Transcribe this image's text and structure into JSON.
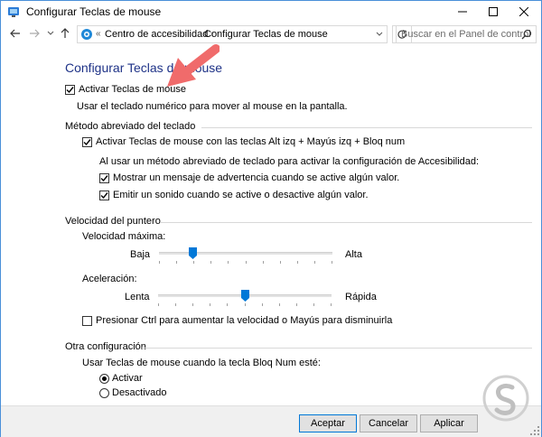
{
  "window": {
    "title": "Configurar Teclas de mouse"
  },
  "address": {
    "chevron": "«",
    "crumbs": [
      "Centro de accesibilidad",
      "Configurar Teclas de mouse"
    ],
    "search_placeholder": "Buscar en el Panel de control"
  },
  "page": {
    "heading": "Configurar Teclas de mouse",
    "activate_label": "Activar Teclas de mouse",
    "activate_checked": true,
    "activate_desc": "Usar el teclado numérico para mover al mouse en la pantalla.",
    "shortcut": {
      "title": "Método abreviado del teclado",
      "enable_label": "Activar Teclas de mouse con las teclas Alt izq + Mayús izq + Bloq num",
      "enable_checked": true,
      "info": "Al usar un método abreviado de teclado para activar la configuración de Accesibilidad:",
      "warning_label": "Mostrar un mensaje de advertencia cuando se active algún valor.",
      "warning_checked": true,
      "sound_label": "Emitir un sonido cuando se active o desactive algún valor.",
      "sound_checked": true
    },
    "pointer": {
      "title": "Velocidad del puntero",
      "max_speed_label": "Velocidad máxima:",
      "max_low": "Baja",
      "max_high": "Alta",
      "max_speed_value": 0.18,
      "accel_label": "Aceleración:",
      "accel_low": "Lenta",
      "accel_high": "Rápida",
      "accel_value": 0.5,
      "ctrl_label": "Presionar Ctrl para aumentar la velocidad o Mayús para disminuirla",
      "ctrl_checked": false
    },
    "other": {
      "title": "Otra configuración",
      "bloq_label": "Usar Teclas de mouse cuando la tecla Bloq Num esté:",
      "opt_on": "Activar",
      "opt_off": "Desactivado",
      "selected": "Activar"
    }
  },
  "buttons": {
    "ok": "Aceptar",
    "cancel": "Cancelar",
    "apply": "Aplicar"
  },
  "colors": {
    "heading": "#1e3287",
    "accent": "#0078d7",
    "arrow": "#f06b6b"
  },
  "icons": [
    "app-icon",
    "back-arrow-icon",
    "forward-arrow-icon",
    "recent-dropdown-icon",
    "up-arrow-icon",
    "control-panel-icon",
    "refresh-icon",
    "search-icon",
    "minimize-icon",
    "maximize-icon",
    "close-icon"
  ]
}
